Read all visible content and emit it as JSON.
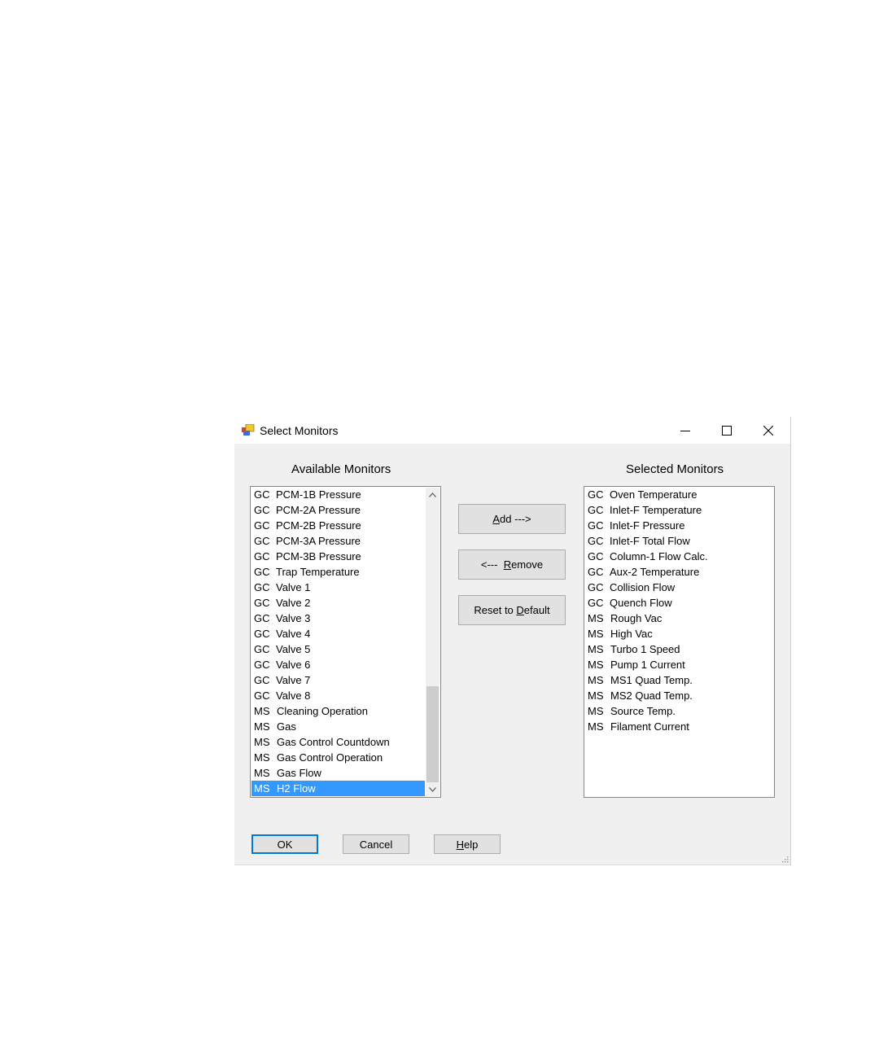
{
  "window": {
    "title": "Select Monitors"
  },
  "available": {
    "label": "Available Monitors",
    "items": [
      {
        "prefix": "GC",
        "name": "PCM-1B Pressure"
      },
      {
        "prefix": "GC",
        "name": "PCM-2A Pressure"
      },
      {
        "prefix": "GC",
        "name": "PCM-2B Pressure"
      },
      {
        "prefix": "GC",
        "name": "PCM-3A Pressure"
      },
      {
        "prefix": "GC",
        "name": "PCM-3B Pressure"
      },
      {
        "prefix": "GC",
        "name": "Trap Temperature"
      },
      {
        "prefix": "GC",
        "name": "Valve 1"
      },
      {
        "prefix": "GC",
        "name": "Valve 2"
      },
      {
        "prefix": "GC",
        "name": "Valve 3"
      },
      {
        "prefix": "GC",
        "name": "Valve 4"
      },
      {
        "prefix": "GC",
        "name": "Valve 5"
      },
      {
        "prefix": "GC",
        "name": "Valve 6"
      },
      {
        "prefix": "GC",
        "name": "Valve 7"
      },
      {
        "prefix": "GC",
        "name": "Valve 8"
      },
      {
        "prefix": "MS",
        "name": "Cleaning Operation"
      },
      {
        "prefix": "MS",
        "name": "Gas"
      },
      {
        "prefix": "MS",
        "name": "Gas Control Countdown"
      },
      {
        "prefix": "MS",
        "name": "Gas Control Operation"
      },
      {
        "prefix": "MS",
        "name": "Gas Flow"
      },
      {
        "prefix": "MS",
        "name": "H2 Flow",
        "selected": true
      }
    ]
  },
  "selected": {
    "label": "Selected Monitors",
    "items": [
      {
        "prefix": "GC",
        "name": "Oven Temperature"
      },
      {
        "prefix": "GC",
        "name": "Inlet-F Temperature"
      },
      {
        "prefix": "GC",
        "name": "Inlet-F Pressure"
      },
      {
        "prefix": "GC",
        "name": "Inlet-F Total Flow"
      },
      {
        "prefix": "GC",
        "name": "Column-1 Flow Calc."
      },
      {
        "prefix": "GC",
        "name": "Aux-2 Temperature"
      },
      {
        "prefix": "GC",
        "name": "Collision Flow"
      },
      {
        "prefix": "GC",
        "name": "Quench Flow"
      },
      {
        "prefix": "MS",
        "name": "Rough Vac"
      },
      {
        "prefix": "MS",
        "name": "High Vac"
      },
      {
        "prefix": "MS",
        "name": "Turbo 1 Speed"
      },
      {
        "prefix": "MS",
        "name": "Pump 1 Current"
      },
      {
        "prefix": "MS",
        "name": "MS1 Quad Temp."
      },
      {
        "prefix": "MS",
        "name": "MS2 Quad Temp."
      },
      {
        "prefix": "MS",
        "name": "Source Temp."
      },
      {
        "prefix": "MS",
        "name": "Filament Current"
      }
    ]
  },
  "buttons": {
    "add": {
      "mnemonic": "A",
      "rest": "dd  --->"
    },
    "remove": {
      "pre": "<---  ",
      "mnemonic": "R",
      "rest": "emove"
    },
    "reset": {
      "pre": "Reset to ",
      "mnemonic": "D",
      "rest": "efault"
    },
    "ok": "OK",
    "cancel": "Cancel",
    "help": {
      "mnemonic": "H",
      "rest": "elp"
    }
  },
  "colors": {
    "selection": "#3399ff",
    "dialog_bg": "#f0f0f0",
    "focus_border": "#0078d7"
  }
}
